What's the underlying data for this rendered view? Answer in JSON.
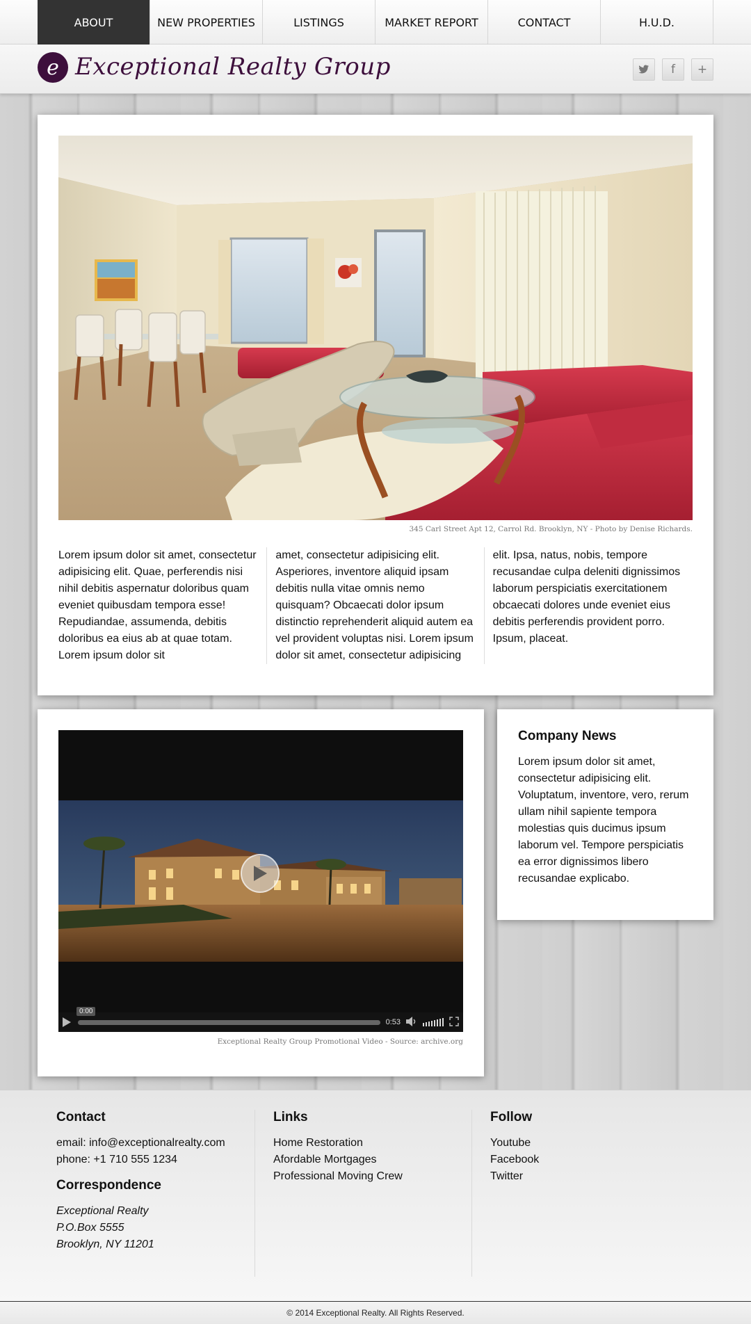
{
  "nav": {
    "items": [
      {
        "label": "ABOUT",
        "active": true
      },
      {
        "label": "NEW PROPERTIES",
        "active": false
      },
      {
        "label": "LISTINGS",
        "active": false
      },
      {
        "label": "MARKET REPORT",
        "active": false
      },
      {
        "label": "CONTACT",
        "active": false
      },
      {
        "label": "H.U.D.",
        "active": false
      }
    ]
  },
  "header": {
    "logo_mark": "e",
    "logo_text": "Exceptional Realty Group",
    "brand_color": "#3d0f3c",
    "social": [
      {
        "icon": "twitter-icon",
        "glyph": "🐦"
      },
      {
        "icon": "facebook-icon",
        "glyph": "f"
      },
      {
        "icon": "google-plus-icon",
        "glyph": "+"
      }
    ]
  },
  "hero": {
    "caption": "345 Carl Street Apt 12, Carrol Rd. Brooklyn, NY - Photo by Denise Richards.",
    "columns": [
      "Lorem ipsum dolor sit amet, consectetur adipisicing elit. Quae, perferendis nisi nihil debitis aspernatur doloribus quam eveniet quibusdam tempora esse! Repudiandae, assumenda, debitis doloribus ea eius ab at quae totam. Lorem ipsum dolor sit",
      "amet, consectetur adipisicing elit. Asperiores, inventore aliquid ipsam debitis nulla vitae omnis nemo quisquam? Obcaecati dolor ipsum distinctio reprehenderit aliquid autem ea vel provident voluptas nisi. Lorem ipsum dolor sit amet, consectetur adipisicing",
      "elit. Ipsa, natus, nobis, tempore recusandae culpa deleniti dignissimos laborum perspiciatis exercitationem obcaecati dolores unde eveniet eius debitis perferendis provident porro. Ipsum, placeat."
    ]
  },
  "video": {
    "current_time": "0:00",
    "duration": "0:53",
    "caption": "Exceptional Realty Group Promotional Video - Source: archive.org"
  },
  "news": {
    "title": "Company News",
    "body": "Lorem ipsum dolor sit amet, consectetur adipisicing elit. Voluptatum, inventore, vero, rerum ullam nihil sapiente tempora molestias quis ducimus ipsum laborum vel. Tempore perspiciatis ea error dignissimos libero recusandae explicabo."
  },
  "footer": {
    "contact_title": "Contact",
    "email": "email: info@exceptionalrealty.com",
    "phone": "phone: +1 710 555 1234",
    "correspondence_title": "Correspondence",
    "address": [
      "Exceptional Realty",
      "P.O.Box 5555",
      "Brooklyn, NY 11201"
    ],
    "links_title": "Links",
    "links": [
      "Home Restoration",
      "Afordable Mortgages",
      "Professional Moving Crew"
    ],
    "follow_title": "Follow",
    "follow": [
      "Youtube",
      "Facebook",
      "Twitter"
    ],
    "copyright": "© 2014 Exceptional Realty. All Rights Reserved."
  }
}
